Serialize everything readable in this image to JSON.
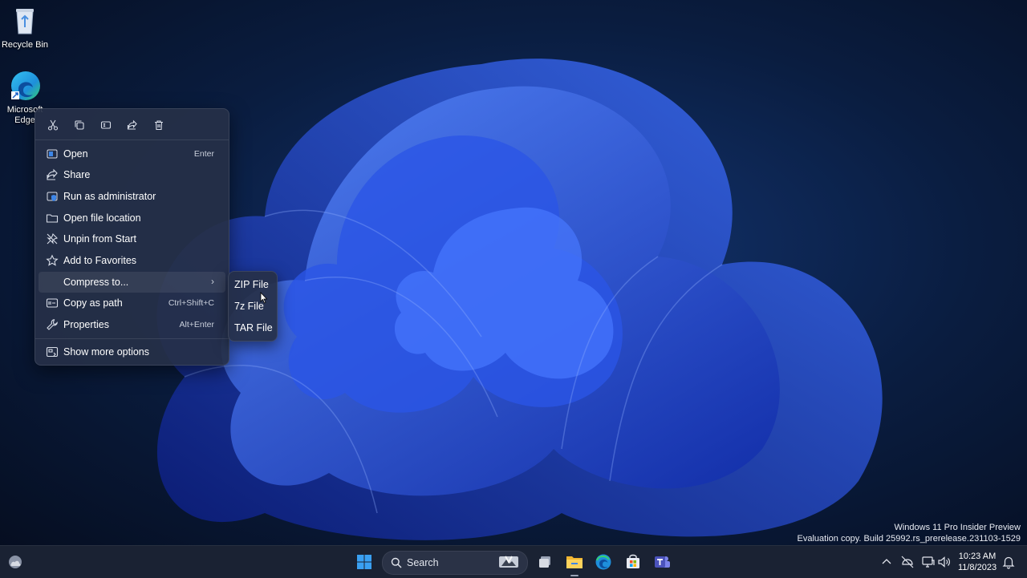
{
  "desktop": {
    "icons": [
      {
        "label": "Recycle Bin",
        "icon": "recycle-bin-icon"
      },
      {
        "label": "Microsoft Edge",
        "icon": "edge-icon"
      }
    ]
  },
  "context_menu": {
    "quick_actions": [
      {
        "name": "cut",
        "icon": "cut-icon"
      },
      {
        "name": "copy",
        "icon": "copy-icon"
      },
      {
        "name": "rename",
        "icon": "rename-icon"
      },
      {
        "name": "share",
        "icon": "share-icon"
      },
      {
        "name": "delete",
        "icon": "delete-icon"
      }
    ],
    "items": [
      {
        "label": "Open",
        "shortcut": "Enter",
        "icon": "open-icon"
      },
      {
        "label": "Share",
        "shortcut": "",
        "icon": "share-icon"
      },
      {
        "label": "Run as administrator",
        "shortcut": "",
        "icon": "shield-icon"
      },
      {
        "label": "Open file location",
        "shortcut": "",
        "icon": "folder-icon"
      },
      {
        "label": "Unpin from Start",
        "shortcut": "",
        "icon": "unpin-icon"
      },
      {
        "label": "Add to Favorites",
        "shortcut": "",
        "icon": "star-icon"
      },
      {
        "label": "Compress to...",
        "shortcut": "",
        "icon": "",
        "submenu": true
      },
      {
        "label": "Copy as path",
        "shortcut": "Ctrl+Shift+C",
        "icon": "copy-path-icon"
      },
      {
        "label": "Properties",
        "shortcut": "Alt+Enter",
        "icon": "wrench-icon"
      }
    ],
    "more_options": {
      "label": "Show more options",
      "icon": "more-options-icon"
    }
  },
  "compress_submenu": {
    "items": [
      "ZIP File",
      "7z File",
      "TAR File"
    ]
  },
  "watermark": {
    "line1": "Windows 11 Pro Insider Preview",
    "line2": "Evaluation copy. Build 25992.rs_prerelease.231103-1529"
  },
  "taskbar": {
    "search_label": "Search",
    "time": "10:23 AM",
    "date": "11/8/2023",
    "apps": [
      "start-icon",
      "search-highlight-icon",
      "task-view-icon",
      "file-explorer-icon",
      "edge-icon",
      "store-icon",
      "teams-icon"
    ],
    "tray": [
      "chevron-up-icon",
      "network-off-icon",
      "display-icon",
      "volume-icon",
      "bell-icon"
    ]
  },
  "colors": {
    "accent": "#1f5ce0",
    "menu_bg": "#263048"
  }
}
